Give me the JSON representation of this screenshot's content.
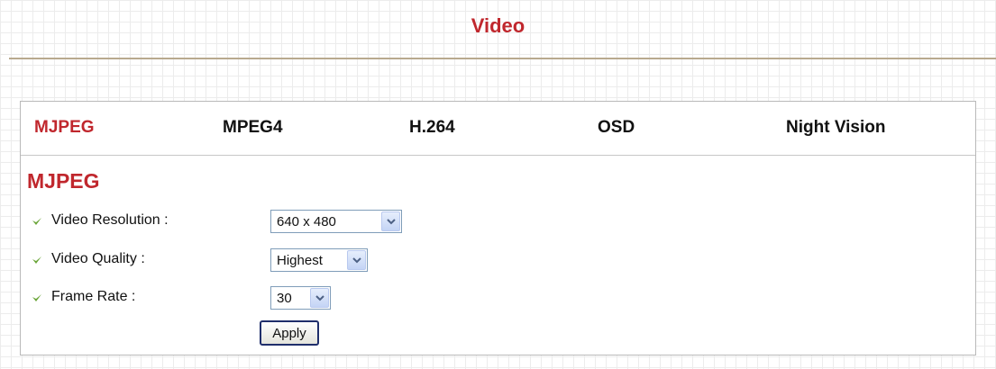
{
  "page": {
    "title": "Video"
  },
  "tabs": [
    {
      "label": "MJPEG",
      "active": true
    },
    {
      "label": "MPEG4",
      "active": false
    },
    {
      "label": "H.264",
      "active": false
    },
    {
      "label": "OSD",
      "active": false
    },
    {
      "label": "Night Vision",
      "active": false
    }
  ],
  "section": {
    "title": "MJPEG"
  },
  "form": {
    "resolution": {
      "label": "Video Resolution :",
      "value": "640 x 480"
    },
    "quality": {
      "label": "Video Quality :",
      "value": "Highest"
    },
    "frame_rate": {
      "label": "Frame Rate :",
      "value": "30"
    },
    "apply_label": "Apply"
  },
  "icons": {
    "bullet": "green-check-icon",
    "dropdown": "chevron-down-icon"
  },
  "colors": {
    "accent": "#c0272d",
    "bullet": "#6aa538",
    "rule": "#b8a98e"
  }
}
